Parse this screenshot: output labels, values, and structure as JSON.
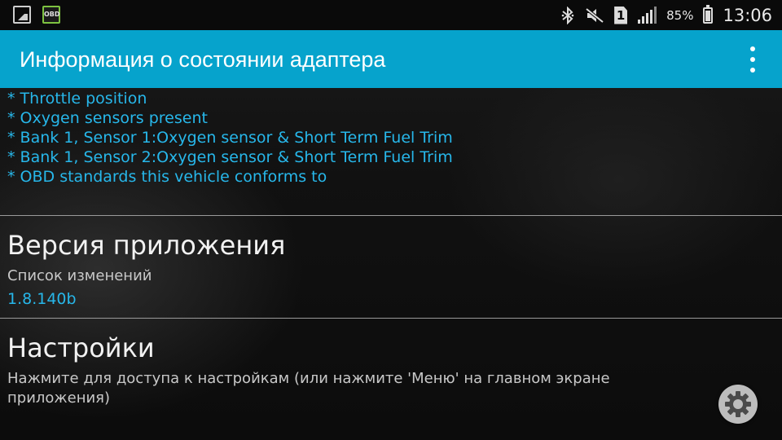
{
  "status_bar": {
    "notifications": [
      {
        "icon": "picture-icon"
      },
      {
        "icon": "obd-app-icon",
        "label": "OBD"
      }
    ],
    "icons": [
      "bluetooth-icon",
      "mute-icon",
      "sim-icon",
      "signal-icon",
      "battery-icon"
    ],
    "sim_slot": "1",
    "battery_percent": "85%",
    "time": "13:06"
  },
  "app_bar": {
    "title": "Информация о состоянии адаптера",
    "overflow_icon": "more-vert-icon",
    "background": "#06a3cc"
  },
  "supported_pids": [
    "* Throttle position",
    "* Oxygen sensors present",
    "* Bank 1, Sensor 1:Oxygen sensor & Short Term Fuel Trim",
    "* Bank 1, Sensor 2:Oxygen sensor & Short Term Fuel Trim",
    "* OBD standards this vehicle conforms to"
  ],
  "app_version": {
    "title": "Версия приложения",
    "summary": "Список изменений",
    "value": "1.8.140b"
  },
  "settings": {
    "title": "Настройки",
    "summary": "Нажмите для доступа к настройкам (или нажмите 'Меню' на главном экране приложения)",
    "fab_icon": "gear-icon"
  },
  "colors": {
    "accent": "#27b7ea",
    "title_text": "#f2f2f2",
    "summary_text": "#c8c8c8"
  }
}
